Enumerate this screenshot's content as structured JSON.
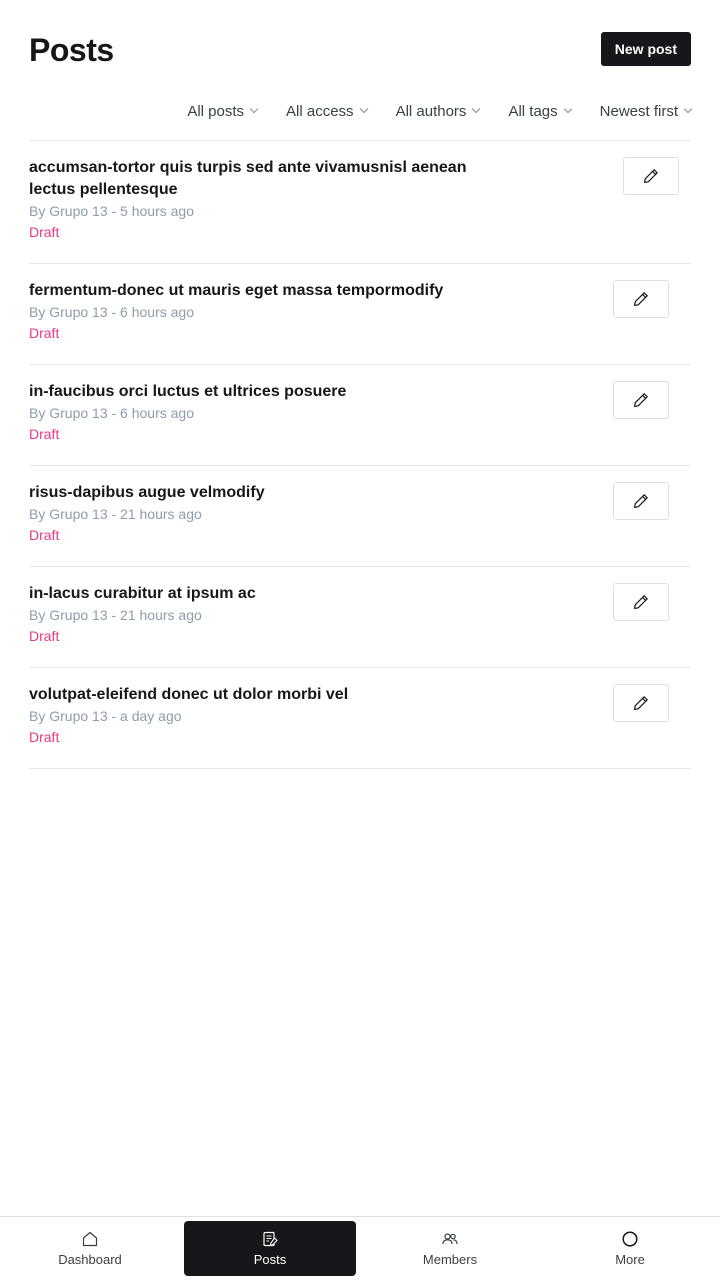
{
  "header": {
    "title": "Posts",
    "new_post_label": "New post"
  },
  "filters": [
    {
      "label": "All posts"
    },
    {
      "label": "All access"
    },
    {
      "label": "All authors"
    },
    {
      "label": "All tags"
    },
    {
      "label": "Newest first"
    }
  ],
  "posts": [
    {
      "title": "accumsan-tortor quis turpis sed ante vivamusnisl aenean lectus pellentesque",
      "meta": "By Grupo 13 - 5 hours ago",
      "status": "Draft"
    },
    {
      "title": "fermentum-donec ut mauris eget massa tempormodify",
      "meta": "By Grupo 13 - 6 hours ago",
      "status": "Draft"
    },
    {
      "title": "in-faucibus orci luctus et ultrices posuere",
      "meta": "By Grupo 13 - 6 hours ago",
      "status": "Draft"
    },
    {
      "title": "risus-dapibus augue velmodify",
      "meta": "By Grupo 13 - 21 hours ago",
      "status": "Draft"
    },
    {
      "title": "in-lacus curabitur at ipsum ac",
      "meta": "By Grupo 13 - 21 hours ago",
      "status": "Draft"
    },
    {
      "title": "volutpat-eleifend donec ut dolor morbi vel",
      "meta": "By Grupo 13 - a day ago",
      "status": "Draft"
    }
  ],
  "tabbar": {
    "items": [
      {
        "label": "Dashboard",
        "icon": "home-icon",
        "active": false
      },
      {
        "label": "Posts",
        "icon": "posts-icon",
        "active": true
      },
      {
        "label": "Members",
        "icon": "members-icon",
        "active": false
      },
      {
        "label": "More",
        "icon": "circle-icon",
        "active": false
      }
    ]
  },
  "colors": {
    "accent_dark": "#15171a",
    "draft_status": "#e53b84",
    "meta_text": "#8e9cac"
  }
}
